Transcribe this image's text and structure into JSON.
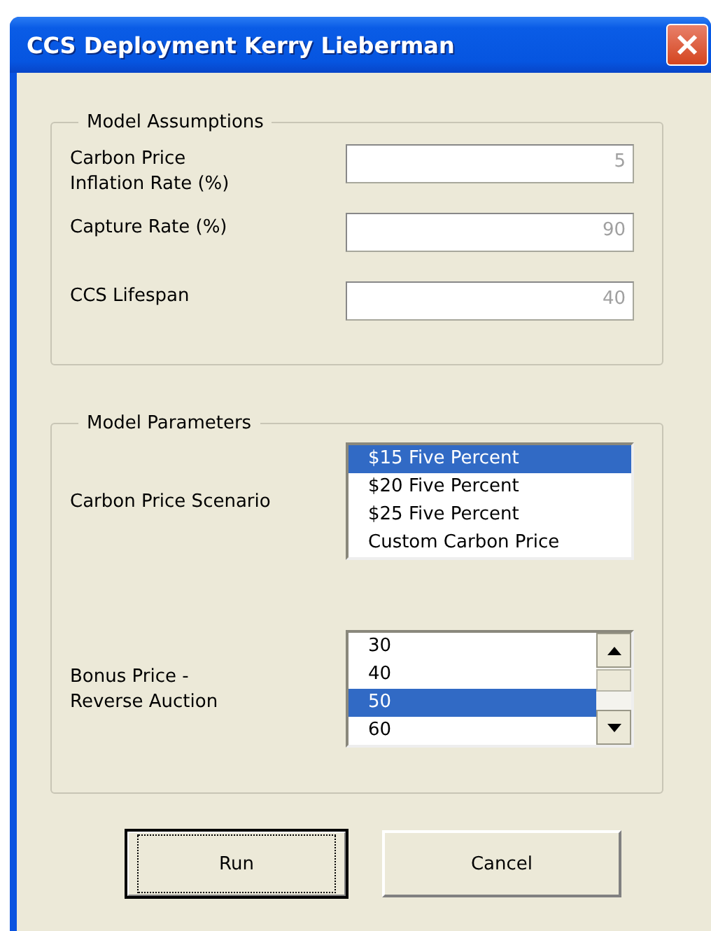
{
  "window": {
    "title": "CCS Deployment Kerry Lieberman"
  },
  "assumptions": {
    "title": "Model Assumptions",
    "fields": [
      {
        "label": "Carbon Price\nInflation Rate (%)",
        "value": "5",
        "disabled": true
      },
      {
        "label": "Capture Rate (%)",
        "value": "90",
        "disabled": true
      },
      {
        "label": "CCS Lifespan",
        "value": "40",
        "disabled": true
      }
    ]
  },
  "parameters": {
    "title": "Model Parameters",
    "lists": [
      {
        "label": "Carbon Price Scenario",
        "scrollbar": false,
        "items": [
          {
            "text": "$15 Five Percent",
            "selected": true
          },
          {
            "text": "$20 Five Percent",
            "selected": false
          },
          {
            "text": "$25 Five Percent",
            "selected": false
          },
          {
            "text": "Custom Carbon Price",
            "selected": false
          }
        ]
      },
      {
        "label": "Bonus Price -\nReverse Auction",
        "scrollbar": true,
        "items": [
          {
            "text": "30",
            "selected": false
          },
          {
            "text": "40",
            "selected": false
          },
          {
            "text": "50",
            "selected": true
          },
          {
            "text": "60",
            "selected": false
          }
        ]
      }
    ]
  },
  "buttons": [
    {
      "label": "Run",
      "default": true
    },
    {
      "label": "Cancel",
      "default": false
    }
  ]
}
